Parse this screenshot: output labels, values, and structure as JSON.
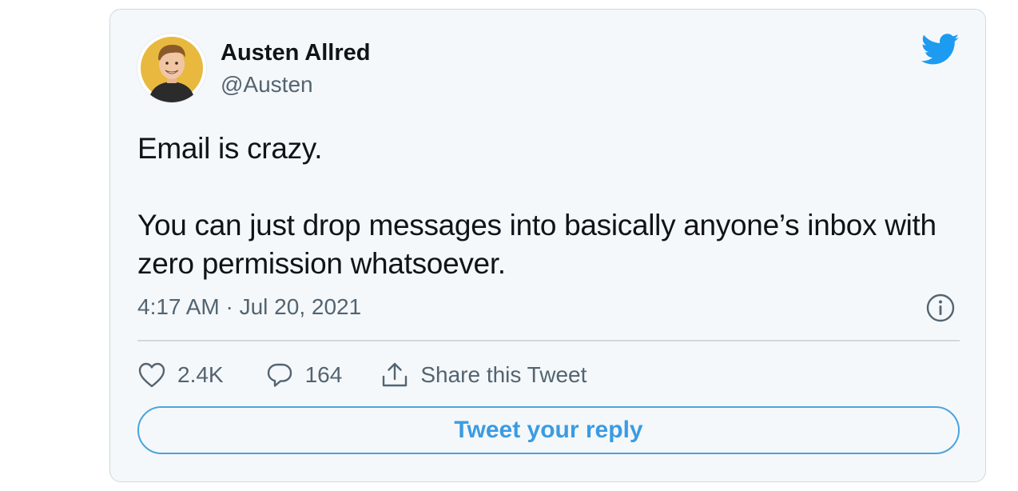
{
  "tweet": {
    "author": {
      "name": "Austen Allred",
      "handle": "@Austen",
      "avatar_icon": "avatar-cartoon-portrait"
    },
    "text": [
      "Email is crazy.",
      "You can just drop messages into basically anyone’s inbox with zero permission whatsoever."
    ],
    "timestamp": "4:17 AM · Jul 20, 2021",
    "actions": {
      "likes": "2.4K",
      "replies": "164",
      "share_label": "Share this Tweet"
    },
    "reply_button_label": "Tweet your reply"
  },
  "icons": {
    "brand": "twitter-bird-icon",
    "info": "info-icon",
    "like": "heart-icon",
    "reply": "speech-bubble-icon",
    "share": "share-upload-icon"
  },
  "colors": {
    "brand_blue": "#1d9bf0",
    "card_background": "#f5f8fa",
    "reply_button_border": "#4aa3df",
    "text_primary": "#0f1419",
    "text_secondary": "#536471"
  }
}
